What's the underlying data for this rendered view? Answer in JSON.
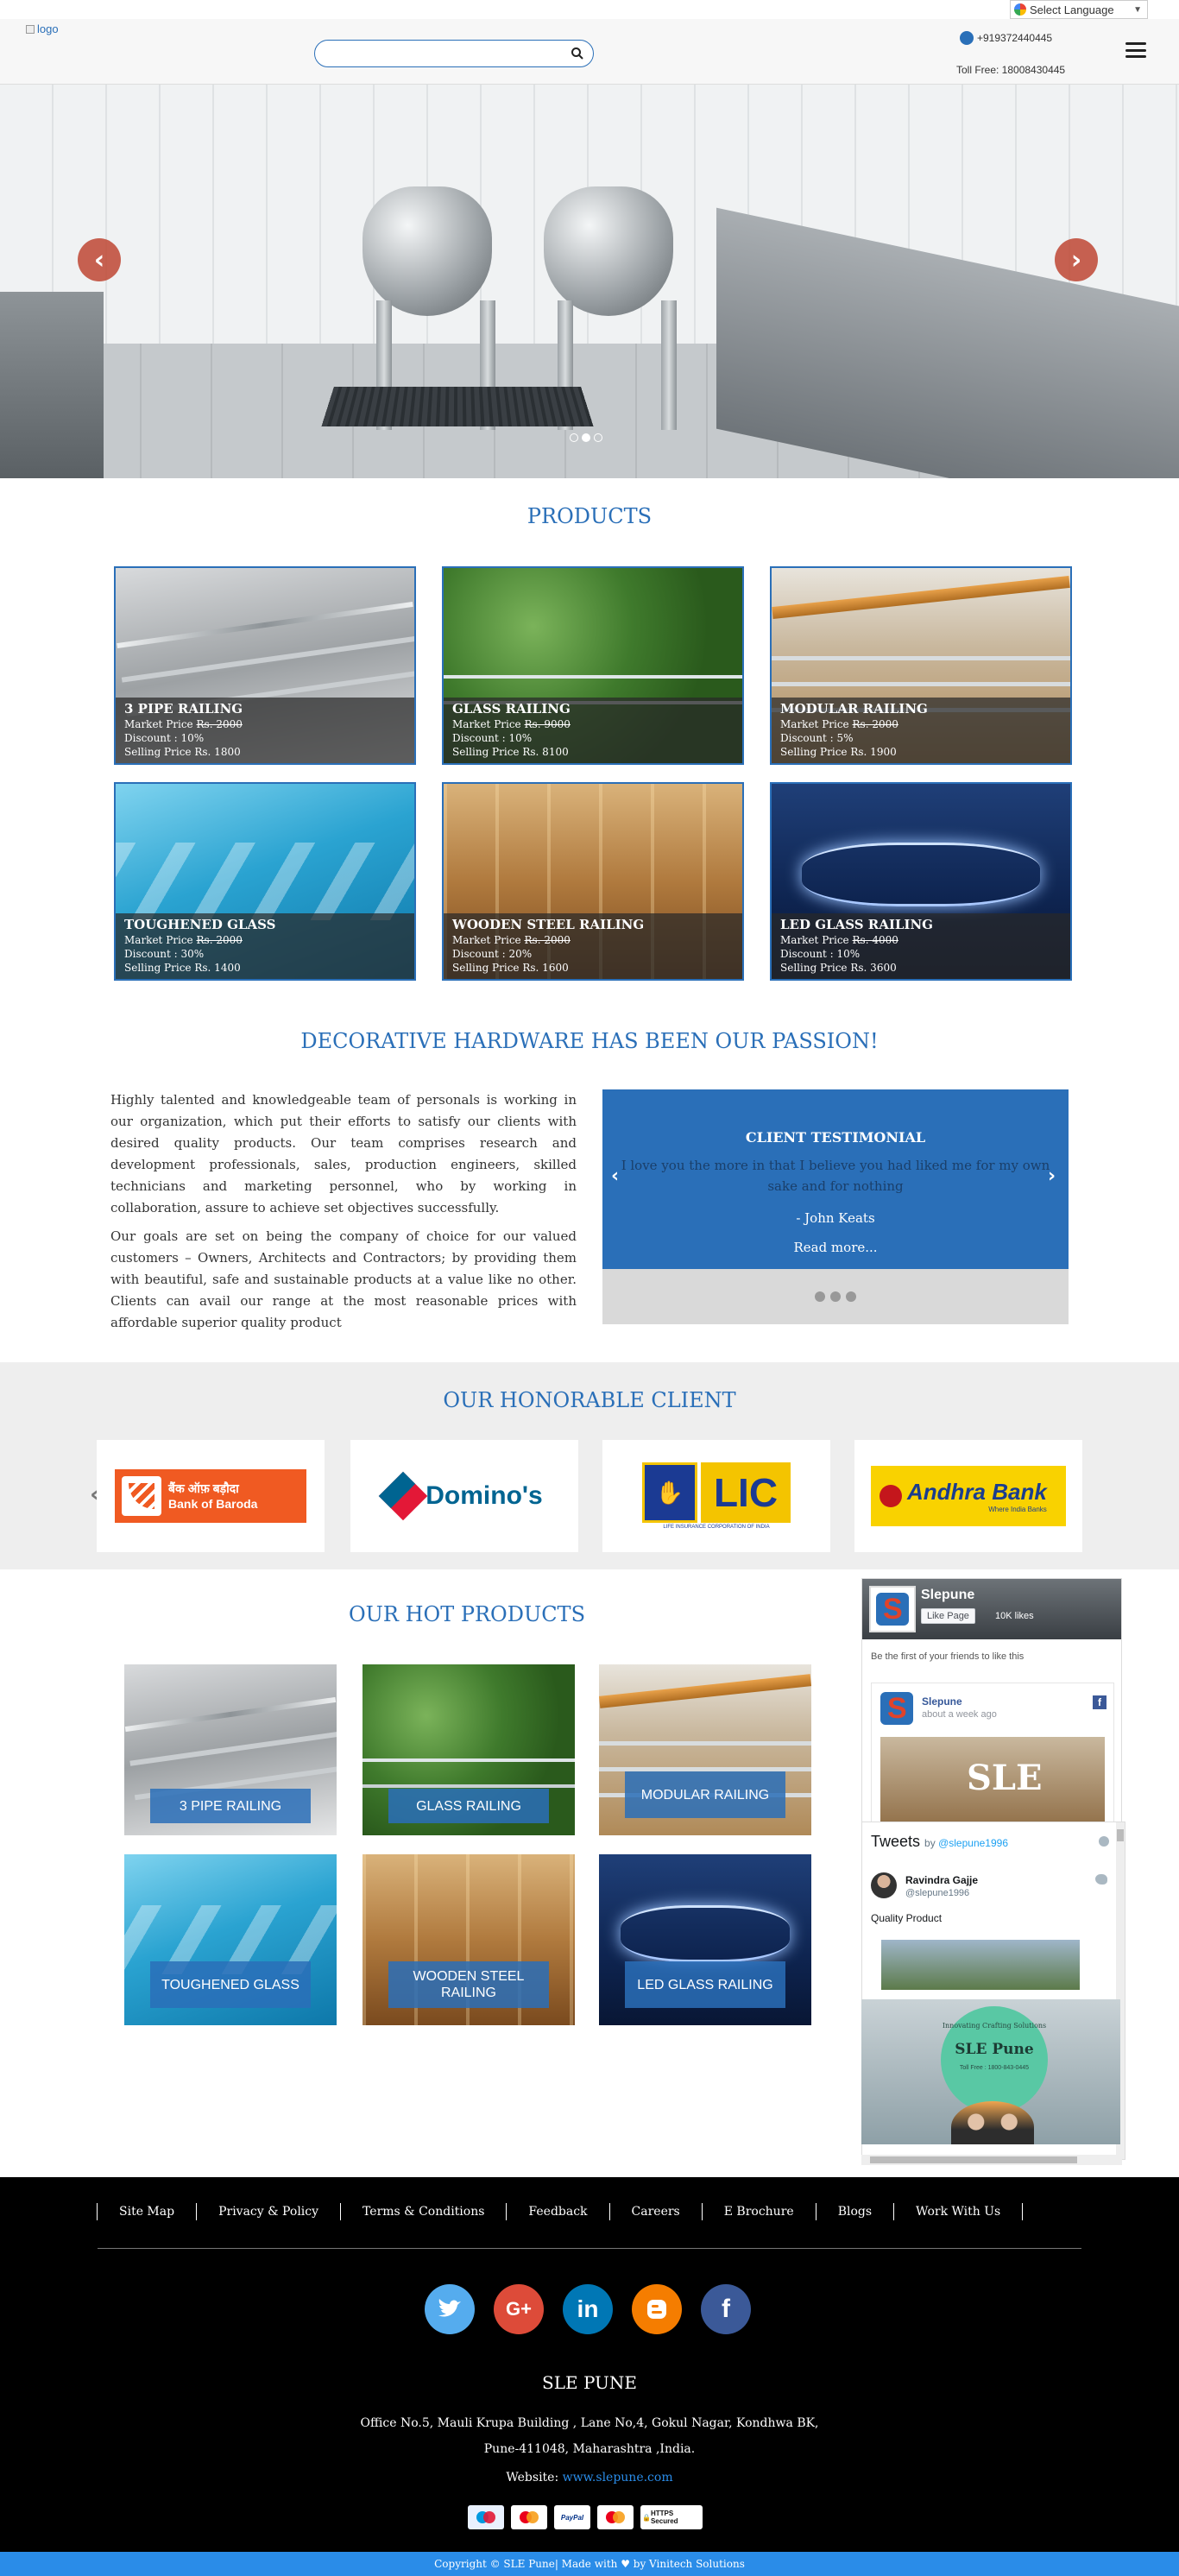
{
  "header": {
    "language_label": "Select Language",
    "logo_alt": "logo",
    "search_placeholder": "",
    "phone": "+919372440445",
    "toll_free": "Toll Free: 18008430445"
  },
  "hero": {
    "prev_icon": "chevron-left",
    "next_icon": "chevron-right",
    "slide_count": 3,
    "active_slide": 2
  },
  "products": {
    "title": "PRODUCTS",
    "market_label": "Market Price",
    "discount_label": "Discount",
    "selling_label": "Selling Price",
    "items": [
      {
        "name": "3 PIPE RAILING",
        "market_price": "Rs. 2000",
        "discount": "10%",
        "selling_price": "Rs. 1800"
      },
      {
        "name": "GLASS RAILING",
        "market_price": "Rs. 9000",
        "discount": "10%",
        "selling_price": "Rs. 8100"
      },
      {
        "name": "MODULAR RAILING",
        "market_price": "Rs. 2000",
        "discount": "5%",
        "selling_price": "Rs. 1900"
      },
      {
        "name": "TOUGHENED GLASS",
        "market_price": "Rs. 2000",
        "discount": "30%",
        "selling_price": "Rs. 1400"
      },
      {
        "name": "WOODEN STEEL RAILING",
        "market_price": "Rs. 2000",
        "discount": "20%",
        "selling_price": "Rs. 1600"
      },
      {
        "name": "LED GLASS RAILING",
        "market_price": "Rs. 4000",
        "discount": "10%",
        "selling_price": "Rs. 3600"
      }
    ]
  },
  "passion": {
    "title": "DECORATIVE HARDWARE HAS BEEN OUR PASSION!",
    "para1": "Highly talented and knowledgeable team of personals is working in our organization, which put their efforts to satisfy our clients with desired quality products. Our team comprises research and development professionals, sales, production engineers, skilled technicians and marketing personnel, who by working in collaboration, assure to achieve set objectives successfully.",
    "para2": "Our goals are set on being the company of choice for our valued customers – Owners, Architects and Contractors; by providing them with beautiful, safe and sustainable products at a value like no other. Clients can avail our range at the most reasonable prices with affordable superior quality product"
  },
  "testimonial": {
    "heading": "CLIENT TESTIMONIAL",
    "quote": "I love you the more in that I believe you had liked me for my own sake and for nothing",
    "author": "- John Keats",
    "read_more": "Read more..."
  },
  "clients": {
    "title": "OUR HONORABLE CLIENT",
    "bob_hindi": "बैंक ऑफ़ बड़ौदा",
    "bob_english": "Bank of Baroda",
    "dominos": "Domino's",
    "lic": "LIC",
    "lic_sub": "LIFE INSURANCE CORPORATION OF INDIA",
    "andhra": "Andhra Bank",
    "andhra_sub": "Where India Banks"
  },
  "hot_products": {
    "title": "OUR HOT PRODUCTS",
    "items": [
      "3 PIPE RAILING",
      "GLASS RAILING",
      "MODULAR RAILING",
      "TOUGHENED GLASS",
      "WOODEN STEEL RAILING",
      "LED GLASS RAILING"
    ]
  },
  "facebook": {
    "page_name": "Slepune",
    "like_button": "Like Page",
    "likes": "10K likes",
    "first_friends": "Be the first of your friends to like this",
    "post_author": "Slepune",
    "post_time": "about a week ago",
    "post_image_text": "SLE"
  },
  "twitter": {
    "title": "Tweets",
    "by": "by",
    "handle_link": "@slepune1996",
    "user_name": "Ravindra Gajje",
    "user_handle": "@slepune1996",
    "tweet_text": "Quality Product"
  },
  "sle_banner": {
    "tagline": "Innovating Crafting Solutions",
    "name": "SLE Pune",
    "toll": "Toll Free : 1800-843-0445"
  },
  "footer": {
    "links": [
      "Site Map",
      "Privacy & Policy",
      "Terms & Conditions",
      "Feedback",
      "Careers",
      "E Brochure",
      "Blogs",
      "Work With Us"
    ],
    "company": "SLE PUNE",
    "address_line1": "Office No.5, Mauli Krupa Building , Lane No,4, Gokul Nagar, Kondhwa BK,",
    "address_line2": "Pune-411048, Maharashtra ,India.",
    "website_label": "Website:",
    "website": "www.slepune.com",
    "payments": [
      "Maestro",
      "MasterCard",
      "PayPal",
      "MasterCard",
      "HTTPS Secured"
    ],
    "copyright": "Copyright © SLE Pune| Made with ♥ by Vinitech Solutions"
  },
  "colors": {
    "brand_blue": "#2a6fb8",
    "footer_bg": "#000000",
    "copyright_bg": "#2a8ce8",
    "slider_arrow": "#be4632"
  }
}
